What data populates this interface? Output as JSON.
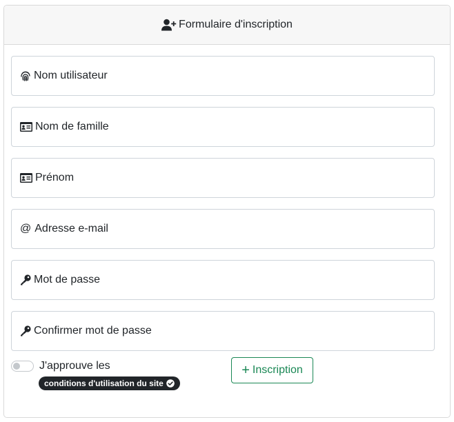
{
  "header": {
    "icon": "user-plus-icon",
    "title": "Formulaire d'inscription"
  },
  "fields": {
    "username": {
      "icon": "fingerprint-icon",
      "placeholder": "Nom utilisateur"
    },
    "lastname": {
      "icon": "id-card-icon",
      "placeholder": "Nom de famille"
    },
    "firstname": {
      "icon": "id-card-icon",
      "placeholder": "Prénom"
    },
    "email": {
      "icon": "at-icon",
      "glyph": "@",
      "placeholder": "Adresse e-mail"
    },
    "password": {
      "icon": "key-icon",
      "placeholder": "Mot de passe"
    },
    "confirm_password": {
      "icon": "key-icon",
      "placeholder": "Confirmer mot de passe"
    }
  },
  "terms": {
    "label": "J'approuve les",
    "badge": "conditions d'utilisation du site",
    "checked": false
  },
  "submit": {
    "label": "Inscription",
    "icon": "plus-icon",
    "glyph": "+"
  },
  "colors": {
    "accent": "#198754",
    "border": "#ced4da",
    "badge_bg": "#212529"
  }
}
